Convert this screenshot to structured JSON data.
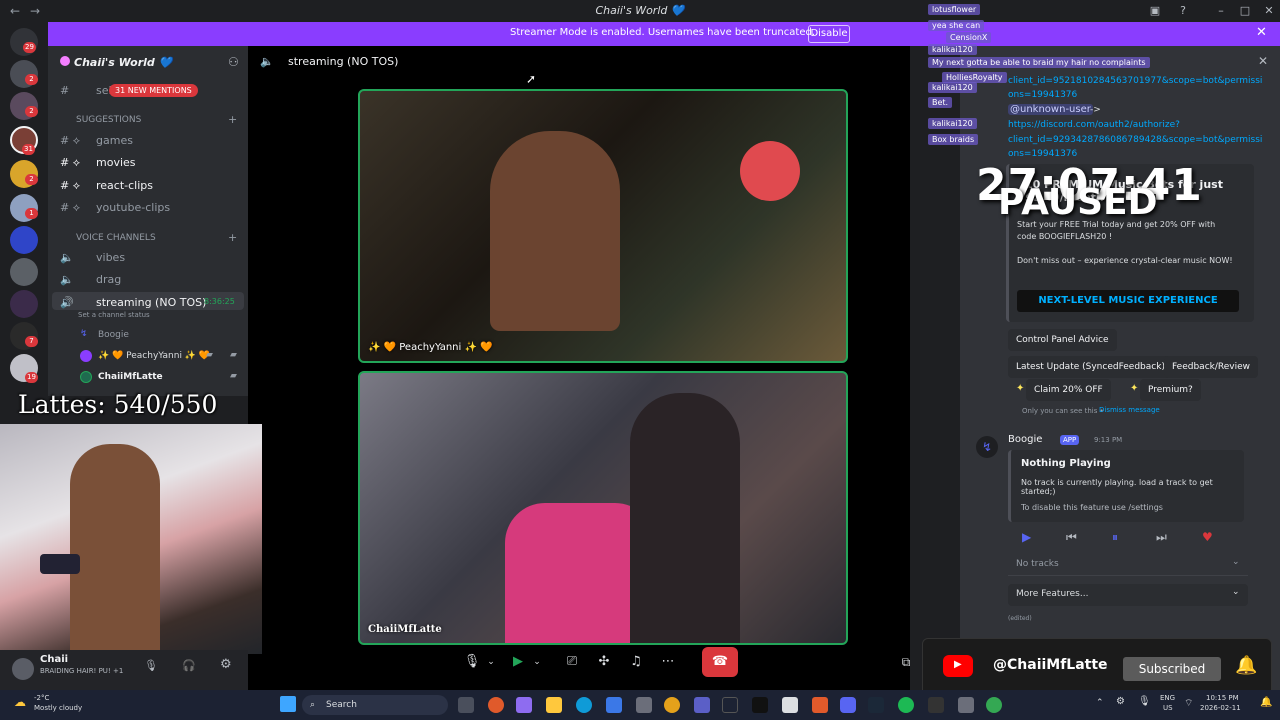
{
  "window": {
    "title": "Chaii's World 💙",
    "heart_color": "#5865f2"
  },
  "banner": {
    "text": "Streamer Mode is enabled. Usernames have been truncated.",
    "button": "Disable"
  },
  "sidebar": {
    "guild_name": "Chaii's World 💙",
    "mentions_badge": "31 NEW MENTIONS",
    "partial_channel": "sel",
    "categories": {
      "suggestions": "SUGGESTIONS",
      "voice": "VOICE CHANNELS"
    },
    "text_channels": [
      "games",
      "movies",
      "react-clips",
      "youtube-clips"
    ],
    "voice_channels": [
      "vibes",
      "drag",
      "streaming (NO TOS)"
    ],
    "active_timer": "8:36:25",
    "channel_status": "Set a channel status",
    "members": [
      "Boogie",
      "✨ 🧡 PeachyYanni ✨ 🧡",
      "ChaiiMfLatte"
    ]
  },
  "rail_badges": [
    "29",
    "2",
    "2",
    "31",
    "2",
    "1",
    "7",
    "19"
  ],
  "overlay": {
    "lattes": "Lattes: 540/550",
    "clock": "27:07:41",
    "paused": "PAUSED"
  },
  "userbar": {
    "name": "Chaii",
    "status": "BRAIDING HAIR! PU! +1"
  },
  "stage": {
    "title": "streaming (NO TOS)",
    "tile1_name": "✨ 🧡 PeachyYanni ✨ 🧡",
    "tile2_name": "ChaiiMfLatte"
  },
  "chat": {
    "lines": [
      "lotusflower",
      "yea she can",
      "CensionX",
      "kalikai120",
      "My next gotta be able to braid my hair no complaints",
      "HolliesRoyalty",
      "kalikai120",
      "Bet.",
      "kalikai120",
      "Box braids"
    ]
  },
  "rpanel": {
    "link1_a": "client_id=9521810284563701977&scope=bot&permissi",
    "link1_b": "ons=19941376",
    "mention": "@unknown-user",
    "arrow": "->",
    "link2_a": "https://discord.com/oauth2/authorize?",
    "link2_b": "client_id=9293428786086789428&scope=bot&permissi",
    "link2_c": "ons=19941376",
    "promo_title": "10 PREMIUM Music Bots for just $2.49/month",
    "promo_start": "Start your FREE Trial today and get 20% OFF with",
    "promo_code": "code BOOGIEFLASH20 !",
    "promo_miss": "Don't miss out – experience crystal-clear music NOW!",
    "promo_banner": "NEXT-LEVEL MUSIC EXPERIENCE",
    "btn_advice": "Control Panel Advice",
    "btn_update": "Latest Update (SyncedFeedback)",
    "btn_feedback": "Feedback/Review",
    "btn_claim": "Claim 20% OFF",
    "btn_premium": "Premium?",
    "only_you": "Only you can see this • ",
    "dismiss": "Dismiss message",
    "bot_name": "Boogie",
    "bot_tag": "APP",
    "bot_time": "9:13 PM",
    "now_title": "Nothing Playing",
    "now_body": "No track is currently playing. load a track to get started;)",
    "now_hint": "To disable this feature use /settings",
    "no_tracks": "No tracks",
    "more": "More Features...",
    "edited": "(edited)"
  },
  "youtube": {
    "handle": "@ChaiiMfLatte",
    "button": "Subscribed",
    "brand_color": "#ff0000"
  },
  "taskbar": {
    "weather_temp": "-2°C",
    "weather_text": "Mostly cloudy",
    "search": "Search",
    "lang": "ENG",
    "region": "US",
    "time": "10:15 PM",
    "date": "2026-02-11"
  }
}
